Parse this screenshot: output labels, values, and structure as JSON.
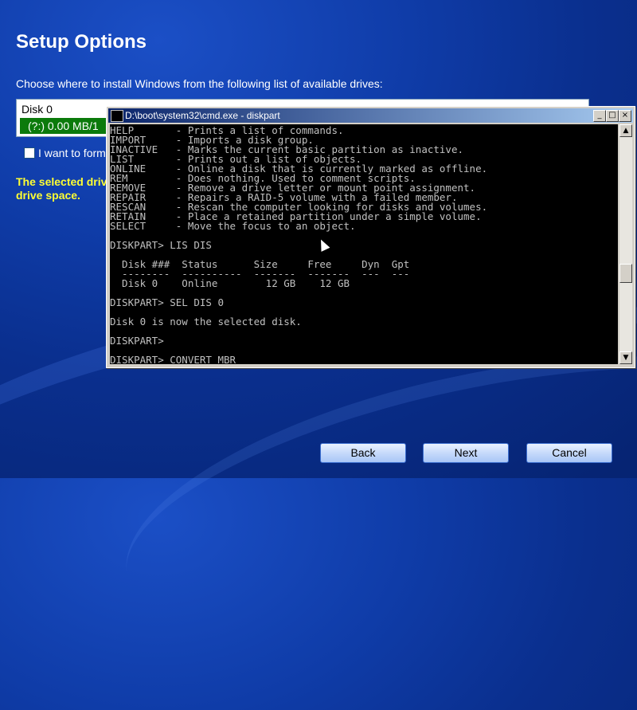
{
  "page": {
    "title": "Setup Options",
    "subtitle": "Choose where to install Windows from the following list of available drives:"
  },
  "drives": {
    "header": "Disk 0",
    "selected_row": "(?:) 0.00 MB/1"
  },
  "format_checkbox": {
    "label": "I want to form",
    "checked": false
  },
  "warning": {
    "text": "The selected drive drive space."
  },
  "cmd": {
    "title": "D:\\boot\\system32\\cmd.exe - diskpart",
    "lines": [
      "HELP       - Prints a list of commands.",
      "IMPORT     - Imports a disk group.",
      "INACTIVE   - Marks the current basic partition as inactive.",
      "LIST       - Prints out a list of objects.",
      "ONLINE     - Online a disk that is currently marked as offline.",
      "REM        - Does nothing. Used to comment scripts.",
      "REMOVE     - Remove a drive letter or mount point assignment.",
      "REPAIR     - Repairs a RAID-5 volume with a failed member.",
      "RESCAN     - Rescan the computer looking for disks and volumes.",
      "RETAIN     - Place a retained partition under a simple volume.",
      "SELECT     - Move the focus to an object.",
      "",
      "DISKPART> LIS DIS",
      "",
      "  Disk ###  Status      Size     Free     Dyn  Gpt",
      "  --------  ----------  -------  -------  ---  ---",
      "  Disk 0    Online        12 GB    12 GB",
      "",
      "DISKPART> SEL DIS 0",
      "",
      "Disk 0 is now the selected disk.",
      "",
      "DISKPART>",
      "",
      "DISKPART> CONVERT MBR"
    ]
  },
  "buttons": {
    "back": "Back",
    "next": "Next",
    "cancel": "Cancel"
  },
  "colors": {
    "selected_drive": "#0b7a0b",
    "warning_text": "#ffff33",
    "titlebar_start": "#0a246a",
    "titlebar_end": "#a6caf0"
  }
}
